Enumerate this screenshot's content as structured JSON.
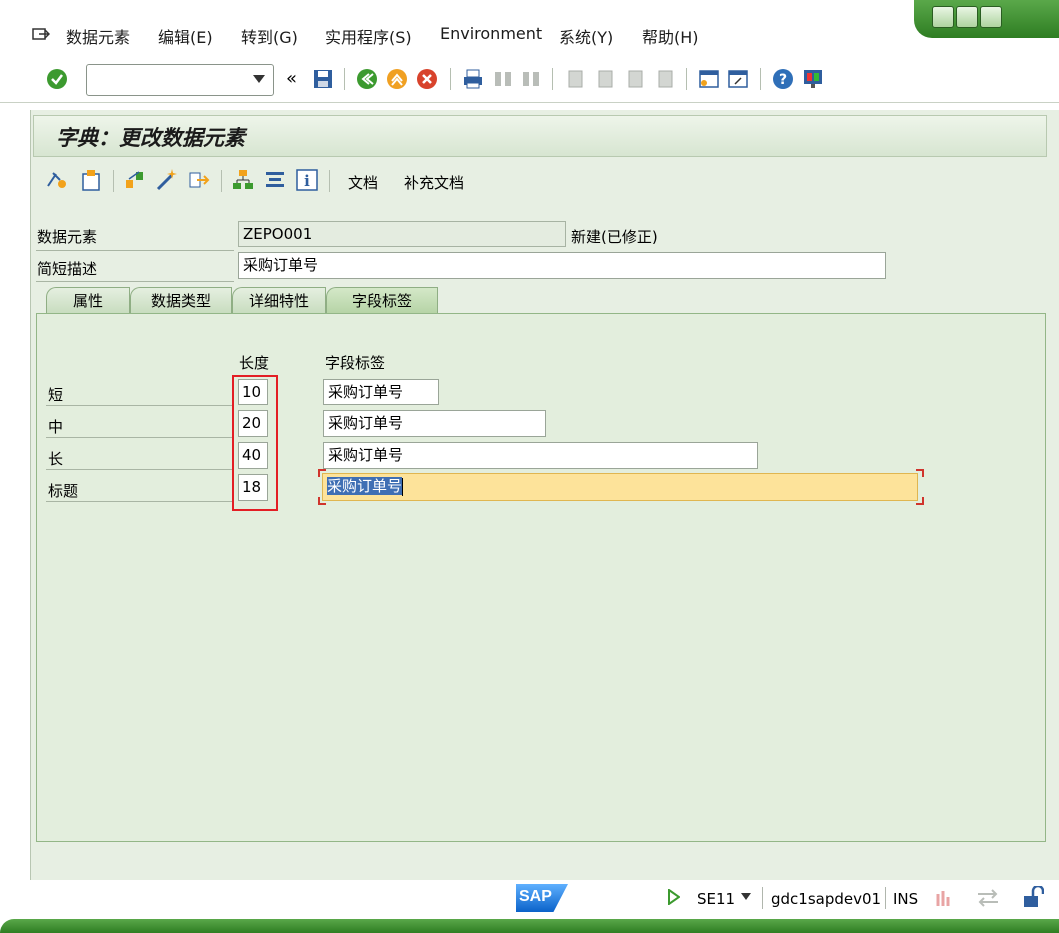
{
  "menu": {
    "items": [
      "数据元素",
      "编辑(E)",
      "转到(G)",
      "实用程序(S)",
      "Environment",
      "系统(Y)",
      "帮助(H)"
    ]
  },
  "toolbar": {
    "command_value": "",
    "icons": [
      "enter-icon",
      "back-icon",
      "exit-icon",
      "cancel-icon",
      "print-icon",
      "find-icon",
      "find-next-icon",
      "first-page-icon",
      "prev-page-icon",
      "next-page-icon",
      "last-page-icon",
      "new-session-icon",
      "shortcut-icon",
      "help-icon",
      "customize-icon"
    ]
  },
  "screen": {
    "title": "字典：更改数据元素"
  },
  "app_toolbar": {
    "documentation_label": "文档",
    "supplementary_doc_label": "补充文档"
  },
  "header": {
    "data_element_label": "数据元素",
    "data_element_value": "ZEPO001",
    "status_text": "新建(已修正)",
    "short_desc_label": "简短描述",
    "short_desc_value": "采购订单号"
  },
  "tabs": [
    {
      "label": "属性",
      "active": false
    },
    {
      "label": "数据类型",
      "active": false
    },
    {
      "label": "详细特性",
      "active": false
    },
    {
      "label": "字段标签",
      "active": true
    }
  ],
  "field_labels": {
    "col_length": "长度",
    "col_label": "字段标签",
    "rows": [
      {
        "name": "短",
        "length": "10",
        "label": "采购订单号"
      },
      {
        "name": "中",
        "length": "20",
        "label": "采购订单号"
      },
      {
        "name": "长",
        "length": "40",
        "label": "采购订单号"
      },
      {
        "name": "标题",
        "length": "18",
        "label": "采购订单号"
      }
    ]
  },
  "status": {
    "logo": "SAP",
    "transaction": "SE11",
    "server": "gdc1sapdev01",
    "mode": "INS"
  }
}
